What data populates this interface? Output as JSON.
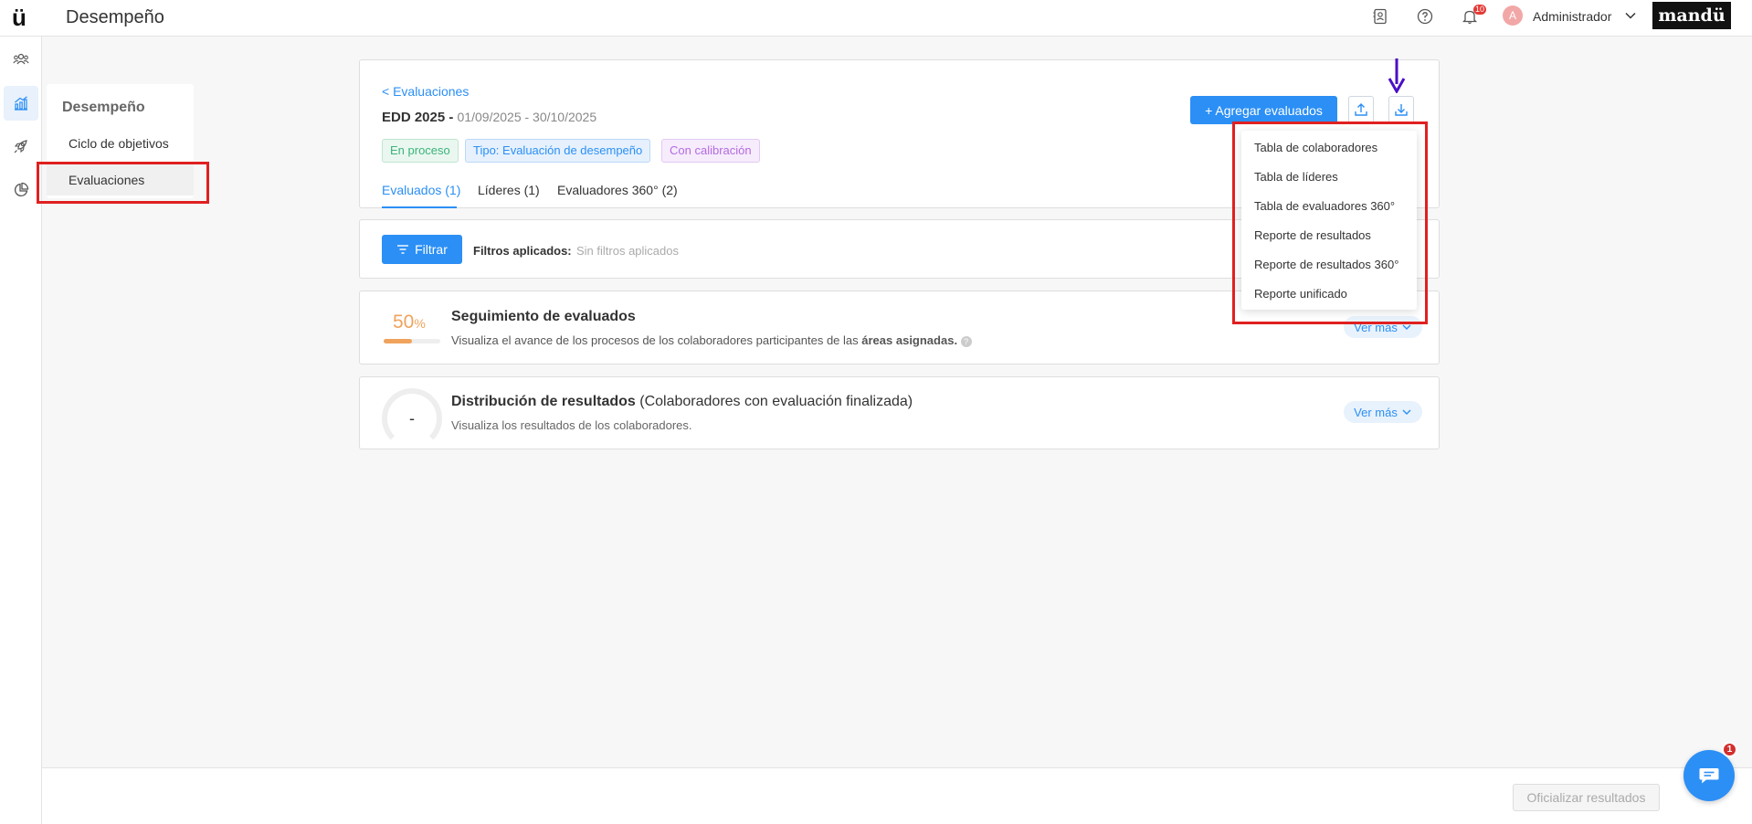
{
  "header": {
    "logo_text": "ü",
    "title": "Desempeño",
    "notification_count": "10",
    "user_initial": "A",
    "user_name": "Administrador",
    "brand": "mandü"
  },
  "submenu": {
    "title": "Desempeño",
    "items": [
      {
        "label": "Ciclo de objetivos"
      },
      {
        "label": "Evaluaciones"
      }
    ]
  },
  "evaluation": {
    "back_link": "< Evaluaciones",
    "name": "EDD 2025 -",
    "dates": "01/09/2025 - 30/10/2025",
    "tags": [
      "En proceso",
      "Tipo: Evaluación de desempeño",
      "Con calibración"
    ],
    "tabs": [
      "Evaluados (1)",
      "Líderes (1)",
      "Evaluadores 360° (2)"
    ],
    "add_button": "+ Agregar evaluados"
  },
  "download_menu": {
    "items": [
      "Tabla de colaboradores",
      "Tabla de líderes",
      "Tabla de evaluadores 360°",
      "Reporte de resultados",
      "Reporte de resultados 360°",
      "Reporte unificado"
    ]
  },
  "filters": {
    "button": "Filtrar",
    "label": "Filtros aplicados:",
    "value": "Sin filtros aplicados"
  },
  "tracking": {
    "percent_value": "50",
    "percent_sign": "%",
    "progress": 0.5,
    "title": "Seguimiento de evaluados",
    "desc_prefix": "Visualiza el avance de los procesos de los colaboradores participantes de las",
    "desc_bold": "áreas asignadas.",
    "ver_mas": "Ver más"
  },
  "distribution": {
    "value": "-",
    "title": "Distribución de resultados",
    "subtitle": "(Colaboradores con evaluación finalizada)",
    "desc": "Visualiza los resultados de los colaboradores.",
    "ver_mas": "Ver más"
  },
  "footer": {
    "button": "Oficializar resultados"
  },
  "chat": {
    "badge": "1"
  },
  "colors": {
    "primary": "#2b8ff5",
    "highlight": "#e02020",
    "arrow": "#4b0fc6",
    "progress": "#f0a35c"
  }
}
